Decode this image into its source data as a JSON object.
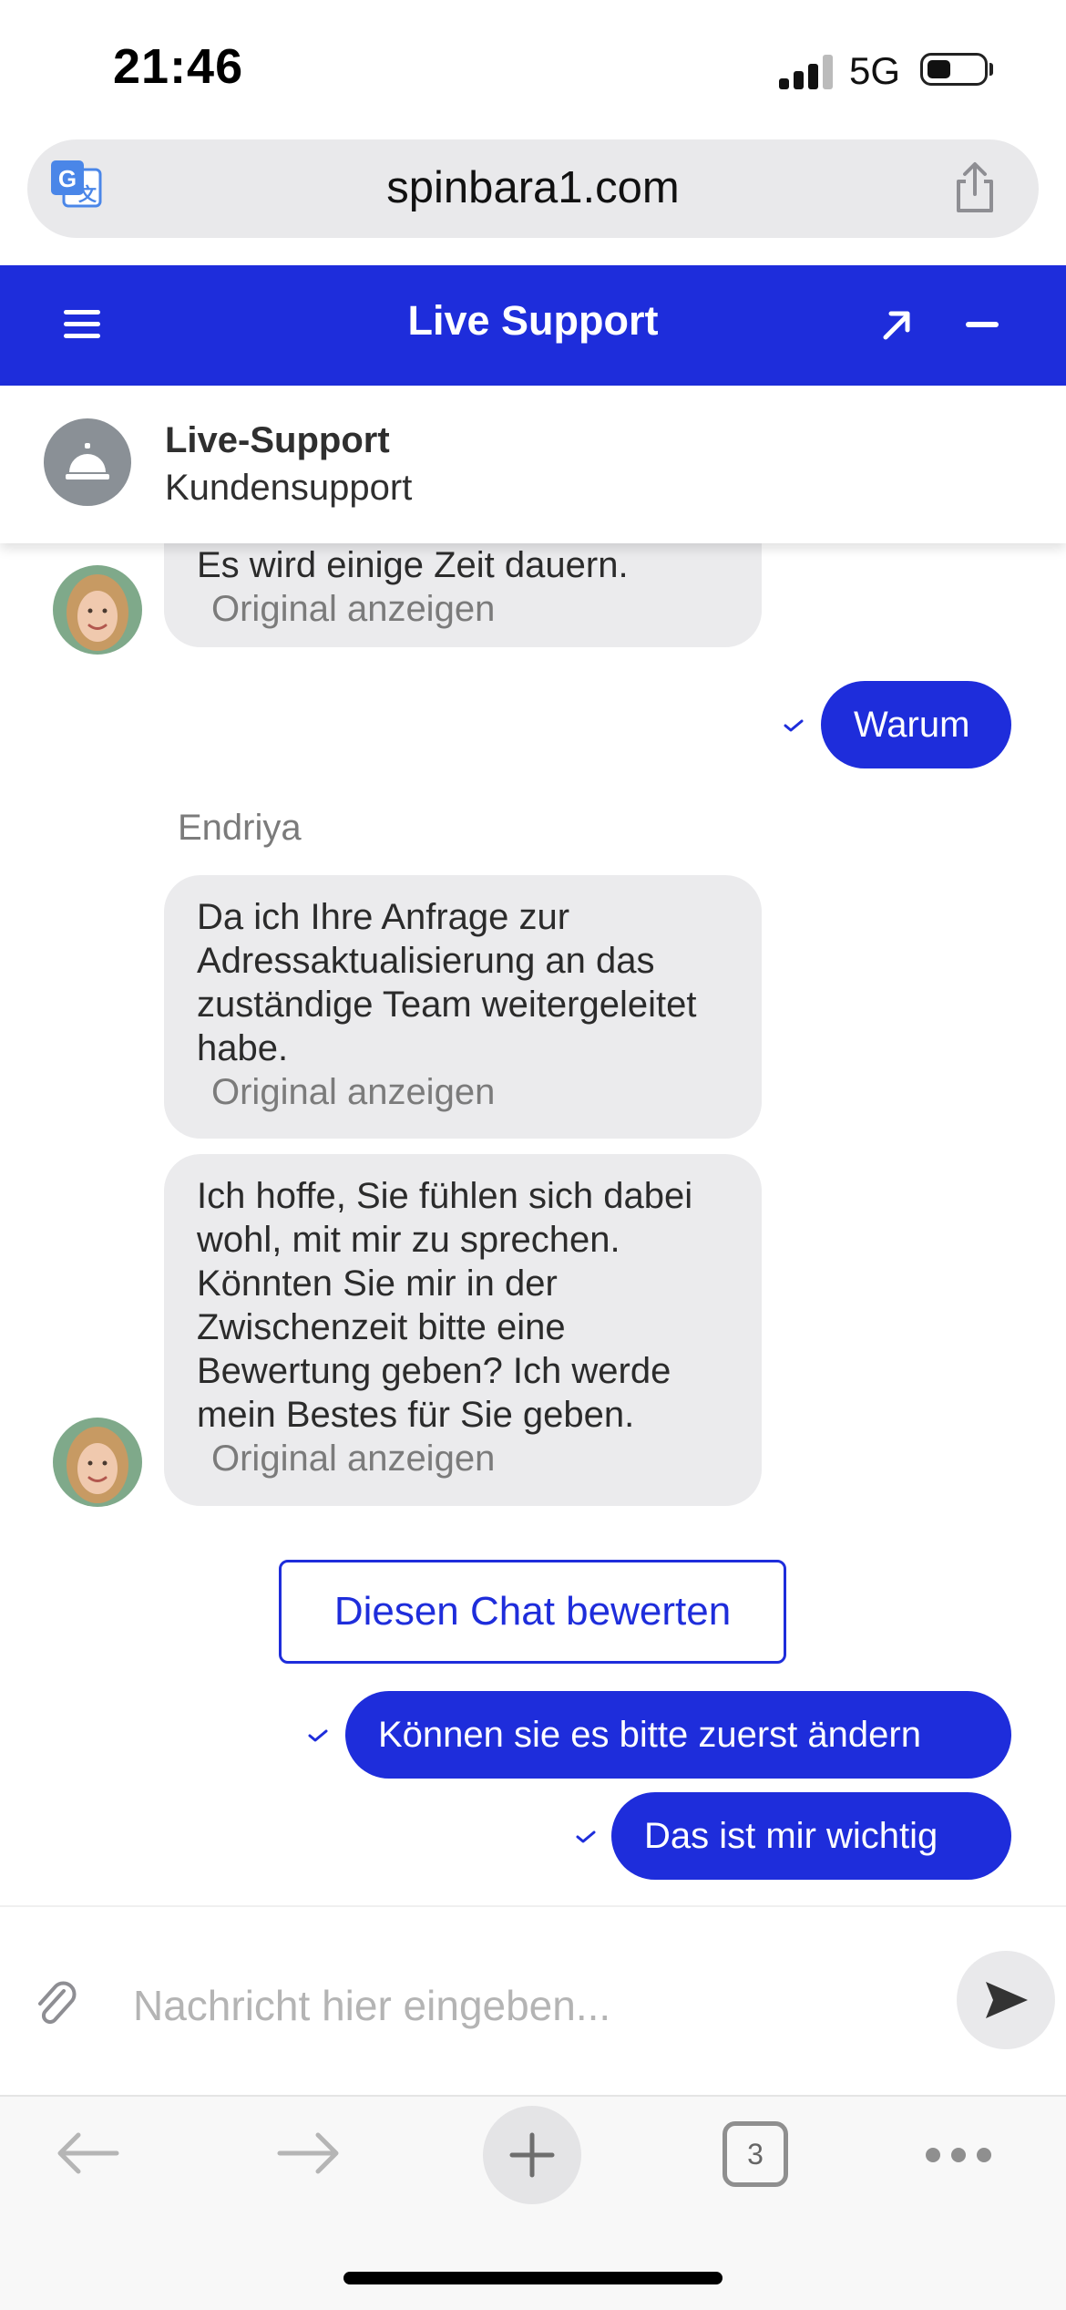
{
  "status_bar": {
    "time": "21:46",
    "network": "5G",
    "battery_level": 0.4
  },
  "browser": {
    "url": "spinbara1.com",
    "tab_count": "3"
  },
  "header": {
    "title": "Live Support"
  },
  "agent": {
    "name": "Live-Support",
    "role": "Kundensupport"
  },
  "messages": [
    {
      "direction": "incoming",
      "text": "Es wird einige Zeit dauern.",
      "original_label": "Original anzeigen"
    },
    {
      "direction": "outgoing",
      "text": "Warum"
    },
    {
      "direction": "sender",
      "text": "Endriya"
    },
    {
      "direction": "incoming",
      "text": "Da ich Ihre Anfrage zur Adressaktualisierung an das zuständige Team weitergeleitet habe.",
      "original_label": "Original anzeigen"
    },
    {
      "direction": "incoming",
      "text": "Ich hoffe, Sie fühlen sich dabei wohl, mit mir zu sprechen. Könnten Sie mir in der Zwischenzeit bitte eine Bewertung geben? Ich werde mein Bestes für Sie geben.",
      "original_label": "Original anzeigen"
    },
    {
      "direction": "outgoing",
      "text": "Können sie es bitte zuerst ändern"
    },
    {
      "direction": "outgoing",
      "text": "Das ist mir wichtig"
    }
  ],
  "rate_button": "Diesen Chat bewerten",
  "composer": {
    "placeholder": "Nachricht hier eingeben..."
  },
  "colors": {
    "accent": "#1e2ddb",
    "incoming_bubble": "#ebebed"
  }
}
